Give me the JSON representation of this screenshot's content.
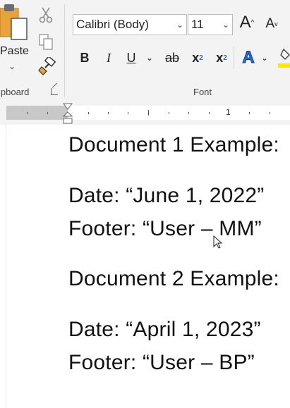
{
  "ribbon": {
    "clipboard": {
      "paste_label": "Paste",
      "group_label": "ipboard"
    },
    "font": {
      "family": "Calibri (Body)",
      "size": "11",
      "group_label": "Font",
      "bold": "B",
      "italic": "I",
      "underline": "U",
      "strikethrough": "ab",
      "subscript": "x",
      "subscript_mark": "2",
      "superscript": "x",
      "superscript_mark": "2",
      "grow": "A",
      "shrink": "A",
      "text_effects": "A"
    }
  },
  "ruler": {
    "number": "1"
  },
  "document": {
    "lines": [
      "Document 1 Example:",
      "Date: “June 1, 2022”",
      "Footer: “User – MM”",
      "Document 2 Example:",
      "Date: “April 1, 2023”",
      "Footer: “User – BP”"
    ]
  },
  "colors": {
    "ribbon_bg": "#f3f3f3",
    "accent_blue": "#2b6fd6",
    "highlight_yellow": "#ffe600"
  },
  "icons": [
    "paste-icon",
    "cut-icon",
    "copy-icon",
    "format-painter-icon",
    "dialog-launcher-icon",
    "grow-font-icon",
    "shrink-font-icon",
    "text-effects-icon",
    "highlight-icon",
    "mouse-cursor-icon"
  ]
}
